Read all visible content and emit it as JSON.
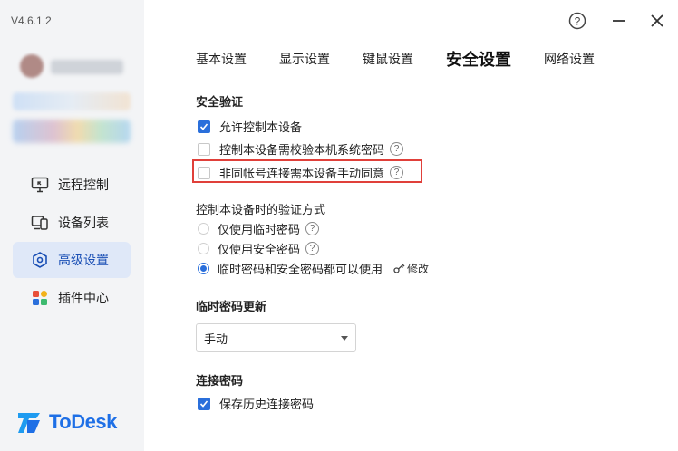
{
  "app": {
    "version": "V4.6.1.2",
    "logo_text": "ToDesk",
    "brand_color": "#1e6fe6",
    "accent_color": "#2a6fdb",
    "highlight_color": "#e0403a"
  },
  "sidebar": {
    "items": [
      {
        "label": "远程控制",
        "icon": "monitor-icon"
      },
      {
        "label": "设备列表",
        "icon": "devices-icon"
      },
      {
        "label": "高级设置",
        "icon": "hexagon-settings-icon",
        "active": true
      },
      {
        "label": "插件中心",
        "icon": "plugin-grid-icon"
      }
    ]
  },
  "window": {
    "help_glyph": "?",
    "minimize_label": "minimize",
    "close_label": "close"
  },
  "tabs": [
    {
      "label": "基本设置"
    },
    {
      "label": "显示设置"
    },
    {
      "label": "键鼠设置"
    },
    {
      "label": "安全设置",
      "active": true
    },
    {
      "label": "网络设置"
    }
  ],
  "security": {
    "title": "安全验证",
    "options": [
      {
        "label": "允许控制本设备",
        "checked": true
      },
      {
        "label": "控制本设备需校验本机系统密码",
        "checked": false,
        "help": "?"
      },
      {
        "label": "非同帐号连接需本设备手动同意",
        "checked": false,
        "help": "?"
      }
    ],
    "auth_title": "控制本设备时的验证方式",
    "auth_options": [
      {
        "label": "仅使用临时密码",
        "selected": false,
        "help": "?"
      },
      {
        "label": "仅使用安全密码",
        "selected": false,
        "help": "?"
      },
      {
        "label": "临时密码和安全密码都可以使用",
        "selected": true
      }
    ],
    "modify_label": "修改"
  },
  "temp_password": {
    "title": "临时密码更新",
    "selected": "手动"
  },
  "connection_password": {
    "title": "连接密码",
    "save_history_label": "保存历史连接密码",
    "save_history_checked": true
  }
}
